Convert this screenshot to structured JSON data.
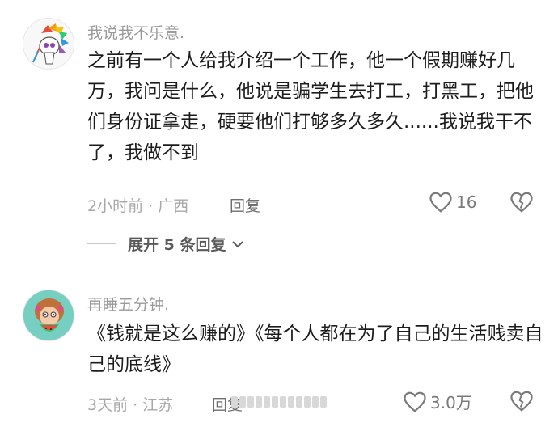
{
  "comments": [
    {
      "username": "我说我不乐意.",
      "content": "之前有一个人给我介绍一个工作，他一个假期赚好几万，我问是什么，他说是骗学生去打工，打黑工，把他们身份证拿走，硬要他们打够多久多久......我说我干不了，我做不到",
      "time": "2小时前",
      "location": "广西",
      "meta": "2小时前 · 广西",
      "reply_label": "回复",
      "like_count": "16",
      "icons": [
        "heart-outline-icon",
        "broken-heart-icon"
      ],
      "replies_toggle": "展开 5 条回复"
    },
    {
      "username": "再睡五分钟.",
      "content": "《钱就是这么赚的》《每个人都在为了自己的生活贱卖自己的底线》",
      "time": "3天前",
      "location": "江苏",
      "meta": "3天前 · 江苏",
      "reply_label": "回复",
      "like_count": "3.0万",
      "icons": [
        "heart-outline-icon",
        "broken-heart-icon"
      ]
    }
  ],
  "colors": {
    "username": "#9a9a9a",
    "content": "#1c1c1c",
    "meta": "#a8a8a8",
    "icon": "#7a7a7a"
  }
}
